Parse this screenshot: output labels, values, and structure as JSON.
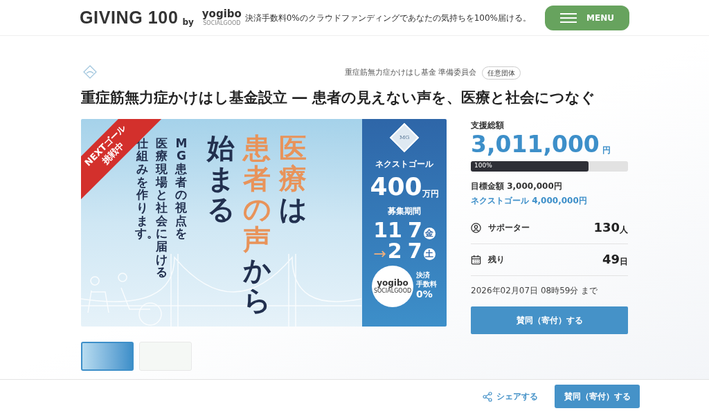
{
  "header": {
    "logo": {
      "main": "GIVING 100",
      "by": "by",
      "brand": "yogibo",
      "brand_sub": "SOCIALGOOD"
    },
    "tagline": "決済手数料0%のクラウドファンディングであなたの気持ちを100%届ける。",
    "menu_button": "MENU"
  },
  "project": {
    "organizer": "重症筋無力症かけはし基金 準備委員会",
    "organizer_badge": "任意団体",
    "title": "重症筋無力症かけはし基金設立 ― 患者の見えない声を、医療と社会につなぐ"
  },
  "banner": {
    "ribbon": [
      "NEXTゴール",
      "挑戦中"
    ],
    "sub_columns": [
      "仕組みを作ります。",
      "医療現場と社会に届ける",
      "MG患者の視点を"
    ],
    "headline_columns": [
      [
        {
          "text": "始まる",
          "accent": false
        }
      ],
      [
        {
          "text": "患者の声",
          "accent": true
        },
        {
          "text": "から",
          "accent": false
        }
      ],
      [
        {
          "text": "医療",
          "accent": true
        },
        {
          "text": "は",
          "accent": false
        }
      ]
    ],
    "side": {
      "logo_text": "MG",
      "next_goal_label": "ネクストゴール",
      "next_goal_amount": "400",
      "next_goal_unit": "万円",
      "period_label": "募集期間",
      "start": {
        "month": "11",
        "day": "7",
        "weekday": "金"
      },
      "end_arrow": "→",
      "end": {
        "month": "2",
        "day": "7",
        "weekday": "土"
      },
      "brand": "yogibo",
      "brand_sub": "SOCIALGOOD",
      "fee_lines": [
        "決済",
        "手数料",
        "0%"
      ]
    }
  },
  "thumbnails": [
    {
      "selected": true
    },
    {
      "selected": false
    }
  ],
  "stats": {
    "total_label": "支援総額",
    "total_amount": "3,011,000",
    "total_unit": "円",
    "progress": {
      "level": 0.75,
      "label": "100%"
    },
    "goal": "目標金額 3,000,000円",
    "next_goal": "ネクストゴール 4,000,000円",
    "rows": [
      {
        "kind": "supporters",
        "label": "サポーター",
        "value": "130",
        "unit": "人"
      },
      {
        "kind": "remaining",
        "label": "残り",
        "value": "49",
        "unit": "日"
      }
    ],
    "deadline": "2026年02月07日 08時59分 まで",
    "support_button": "賛同（寄付）する"
  },
  "footer_bar": {
    "share": "シェアする",
    "support_button": "賛同（寄付）する"
  }
}
